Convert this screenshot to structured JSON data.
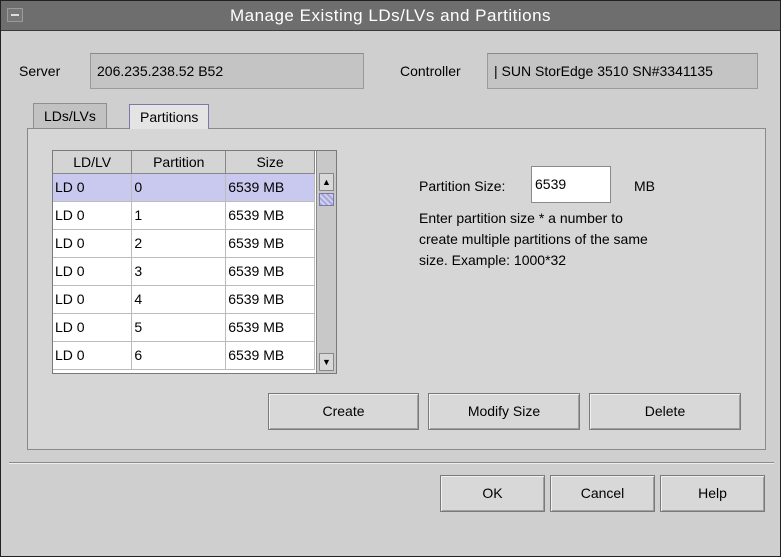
{
  "window": {
    "title": "Manage Existing LDs/LVs and Partitions"
  },
  "server": {
    "label": "Server",
    "value": "206.235.238.52 B52"
  },
  "controller": {
    "label": "Controller",
    "value": "| SUN StorEdge 3510 SN#3341135"
  },
  "tabs": [
    {
      "label": "LDs/LVs",
      "active": false
    },
    {
      "label": "Partitions",
      "active": true
    }
  ],
  "table": {
    "columns": [
      "LD/LV",
      "Partition",
      "Size"
    ],
    "rows": [
      {
        "ldlv": "LD 0",
        "partition": "0",
        "size": "6539 MB",
        "selected": true
      },
      {
        "ldlv": "LD 0",
        "partition": "1",
        "size": "6539 MB",
        "selected": false
      },
      {
        "ldlv": "LD 0",
        "partition": "2",
        "size": "6539 MB",
        "selected": false
      },
      {
        "ldlv": "LD 0",
        "partition": "3",
        "size": "6539 MB",
        "selected": false
      },
      {
        "ldlv": "LD 0",
        "partition": "4",
        "size": "6539 MB",
        "selected": false
      },
      {
        "ldlv": "LD 0",
        "partition": "5",
        "size": "6539 MB",
        "selected": false
      },
      {
        "ldlv": "LD 0",
        "partition": "6",
        "size": "6539 MB",
        "selected": false
      }
    ]
  },
  "partition_size": {
    "label": "Partition Size:",
    "value": "6539",
    "unit": "MB",
    "hint_line1": "Enter partition size * a number to",
    "hint_line2": "create multiple partitions of the same",
    "hint_line3": "size. Example: 1000*32"
  },
  "actions": {
    "create": "Create",
    "modify": "Modify Size",
    "delete": "Delete"
  },
  "footer": {
    "ok": "OK",
    "cancel": "Cancel",
    "help": "Help"
  },
  "colors": {
    "titlebar": "#6e6e6e",
    "selection": "#c9c9ef",
    "background": "#cfcfcf"
  },
  "icons": {
    "window_menu": "window-menu-icon",
    "scroll_up": "scroll-up-arrow-icon",
    "scroll_down": "scroll-down-arrow-icon"
  }
}
